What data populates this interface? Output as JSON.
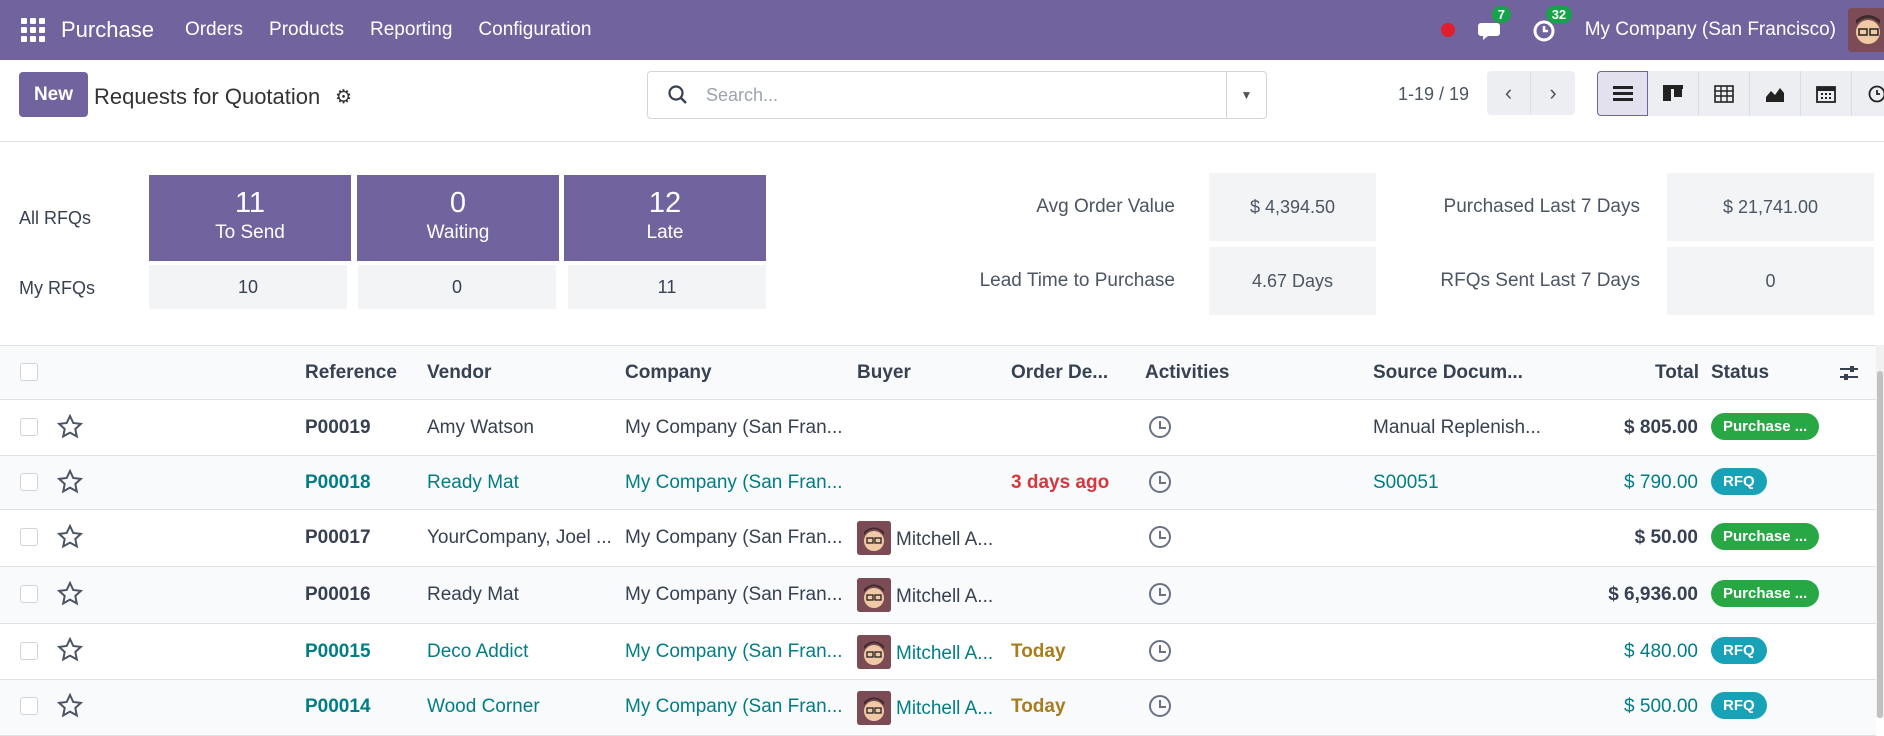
{
  "topbar": {
    "app_name": "Purchase",
    "menu": [
      "Orders",
      "Products",
      "Reporting",
      "Configuration"
    ],
    "messages_count": "7",
    "activities_count": "32",
    "company": "My Company (San Francisco)"
  },
  "control_panel": {
    "new_label": "New",
    "title": "Requests for Quotation",
    "search_placeholder": "Search...",
    "pager": "1-19 / 19"
  },
  "dashboard": {
    "all_label": "All RFQs",
    "my_label": "My RFQs",
    "tiles": [
      {
        "value": "11",
        "label": "To Send",
        "mine": "10"
      },
      {
        "value": "0",
        "label": "Waiting",
        "mine": "0"
      },
      {
        "value": "12",
        "label": "Late",
        "mine": "11"
      }
    ],
    "kpis": {
      "avg_order_label": "Avg Order Value",
      "avg_order_value": "$ 4,394.50",
      "purchased_label": "Purchased Last 7 Days",
      "purchased_value": "$ 21,741.00",
      "lead_time_label": "Lead Time to Purchase",
      "lead_time_value": "4.67 Days",
      "rfqs_sent_label": "RFQs Sent Last 7 Days",
      "rfqs_sent_value": "0"
    }
  },
  "table": {
    "columns": [
      "Reference",
      "Vendor",
      "Company",
      "Buyer",
      "Order De...",
      "Activities",
      "Source Docum...",
      "Total",
      "Status"
    ],
    "rows": [
      {
        "ref": "P00019",
        "vendor": "Amy Watson",
        "company": "My Company (San Fran...",
        "buyer": "",
        "date": "",
        "source": "Manual Replenish...",
        "total": "$ 805.00",
        "status": "Purchase ..."
      },
      {
        "ref": "P00018",
        "vendor": "Ready Mat",
        "company": "My Company (San Fran...",
        "buyer": "",
        "date": "3 days ago",
        "source": "S00051",
        "total": "$ 790.00",
        "status": "RFQ"
      },
      {
        "ref": "P00017",
        "vendor": "YourCompany, Joel ...",
        "company": "My Company (San Fran...",
        "buyer": "Mitchell A...",
        "date": "",
        "source": "",
        "total": "$ 50.00",
        "status": "Purchase ..."
      },
      {
        "ref": "P00016",
        "vendor": "Ready Mat",
        "company": "My Company (San Fran...",
        "buyer": "Mitchell A...",
        "date": "",
        "source": "",
        "total": "$ 6,936.00",
        "status": "Purchase ..."
      },
      {
        "ref": "P00015",
        "vendor": "Deco Addict",
        "company": "My Company (San Fran...",
        "buyer": "Mitchell A...",
        "date": "Today",
        "source": "",
        "total": "$ 480.00",
        "status": "RFQ"
      },
      {
        "ref": "P00014",
        "vendor": "Wood Corner",
        "company": "My Company (San Fran...",
        "buyer": "Mitchell A...",
        "date": "Today",
        "source": "",
        "total": "$ 500.00",
        "status": "RFQ"
      }
    ]
  },
  "colors": {
    "brand": "#71639e",
    "link": "#017e84",
    "late": "#d9363e",
    "today": "#a87e1c",
    "purchase_badge": "#28a745",
    "rfq_badge": "#17a2b8"
  }
}
